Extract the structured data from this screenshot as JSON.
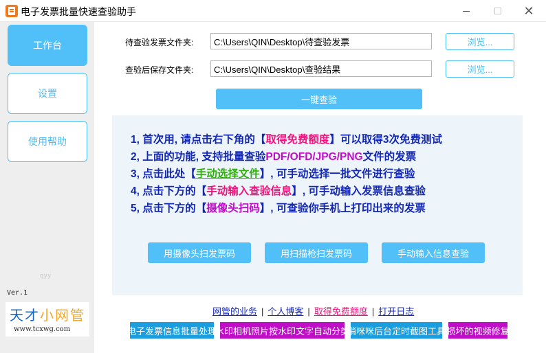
{
  "window": {
    "title": "电子发票批量快速查验助手",
    "icon": "invoice-app-icon",
    "minimize_icon": "minimize-icon",
    "maximize_icon": "maximize-icon",
    "close_symbol": "✕"
  },
  "sidebar": {
    "items": [
      {
        "label": "工作台",
        "active": true
      },
      {
        "label": "设置",
        "active": false
      },
      {
        "label": "使用帮助",
        "active": false
      }
    ],
    "watermark": "qyy",
    "version": "Ver.1",
    "logo": {
      "part1": "天才",
      "part2": "小网管",
      "url": "www.tcxwg.com"
    }
  },
  "form": {
    "source_label": "待查验发票文件夹:",
    "source_value": "C:\\Users\\QIN\\Desktop\\待查验发票",
    "dest_label": "查验后保存文件夹:",
    "dest_value": "C:\\Users\\QIN\\Desktop\\查验结果",
    "browse_label": "浏览...",
    "check_button": "一键查验"
  },
  "info": {
    "line1": {
      "pre": "1, 首次用, 请点击右下角的【",
      "hl": "取得免费额度",
      "post": "】可以取得3次免费测试"
    },
    "line2": {
      "pre": "2, 上面的功能, 支持批量查验",
      "hl": "PDF/OFD/JPG/PNG",
      "post": "文件的发票"
    },
    "line3": {
      "pre": "3, 点击此处【",
      "hl": "手动选择文件",
      "post": "】, 可手动选择一批文件进行查验"
    },
    "line4": {
      "pre": "4, 点击下方的【",
      "hl": "手动输入查验信息",
      "post": "】, 可手动输入发票信息查验"
    },
    "line5": {
      "pre": "5, 点击下方的【",
      "hl": "摄像头扫码",
      "post": "】, 可查验你手机上打印出来的发票"
    }
  },
  "actions": {
    "camera_scan": "用摄像头扫发票码",
    "scanner_gun": "用扫描枪扫发票码",
    "manual_input": "手动输入信息查验"
  },
  "links": {
    "business": "网管的业务",
    "blog": "个人博客",
    "free_quota": "取得免费额度",
    "open_log": "打开日志",
    "separator": "|"
  },
  "ads": {
    "ad1": "电子发票信息批量处理",
    "ad2": "水印相机照片按水印文字自动分类",
    "ad3": "悄咪咪后台定时截图工具",
    "ad4": "损坏的视频修复"
  },
  "colors": {
    "accent": "#52c0f8",
    "text_blue": "#1428b4",
    "highlight_red": "#f0147d",
    "highlight_purple": "#c00ec8",
    "highlight_green": "#2fae0a",
    "sidebar_bg": "#eeeeee",
    "panel_bg": "#edf5fb"
  }
}
